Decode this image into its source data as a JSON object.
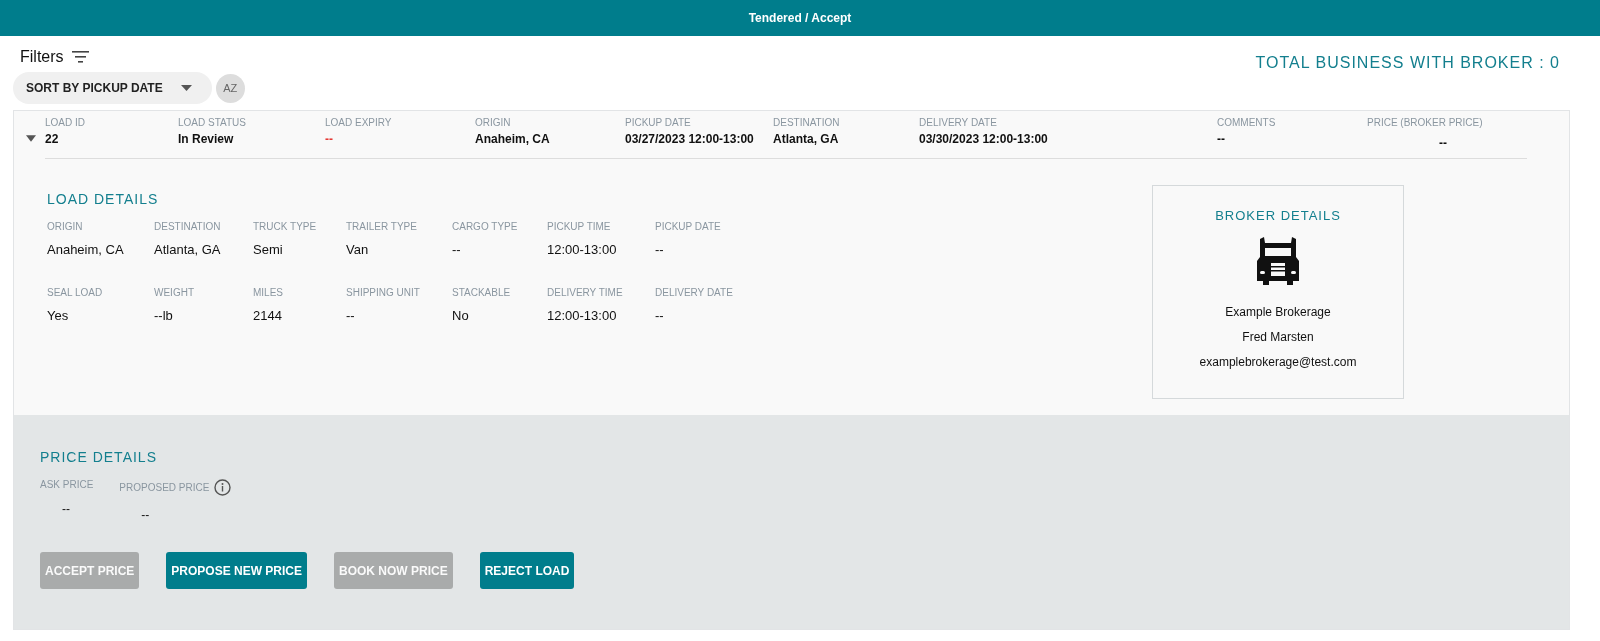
{
  "header": {
    "title": "Tendered / Accept"
  },
  "toolbar": {
    "filters_label": "Filters",
    "sort": {
      "value": "SORT BY PICKUP DATE"
    },
    "sort_order_button": "AZ",
    "total_business": "TOTAL BUSINESS WITH BROKER : 0"
  },
  "load": {
    "expanded": true,
    "summary": [
      {
        "label": "LOAD ID",
        "value": "22",
        "kind": "plain"
      },
      {
        "label": "LOAD STATUS",
        "value": "In Review",
        "kind": "plain"
      },
      {
        "label": "LOAD EXPIRY",
        "value": "--",
        "kind": "alert"
      },
      {
        "label": "ORIGIN",
        "value": "Anaheim, CA",
        "kind": "plain"
      },
      {
        "label": "PICKUP DATE",
        "value": "03/27/2023 12:00-13:00",
        "kind": "plain"
      },
      {
        "label": "DESTINATION",
        "value": "Atlanta, GA",
        "kind": "plain"
      },
      {
        "label": "DELIVERY DATE",
        "value": "03/30/2023 12:00-13:00",
        "kind": "plain"
      },
      {
        "label": "COMMENTS",
        "value": "--",
        "kind": "plain"
      },
      {
        "label": "PRICE (BROKER PRICE)",
        "value": "--",
        "kind": "plain"
      }
    ],
    "load_details": {
      "title": "LOAD DETAILS",
      "rows": [
        [
          {
            "label": "ORIGIN",
            "value": "Anaheim, CA"
          },
          {
            "label": "DESTINATION",
            "value": "Atlanta, GA"
          },
          {
            "label": "TRUCK TYPE",
            "value": "Semi"
          },
          {
            "label": "TRAILER TYPE",
            "value": "Van"
          },
          {
            "label": "CARGO TYPE",
            "value": "--"
          },
          {
            "label": "PICKUP TIME",
            "value": "12:00-13:00"
          },
          {
            "label": "PICKUP DATE",
            "value": "--"
          }
        ],
        [
          {
            "label": "SEAL LOAD",
            "value": "Yes"
          },
          {
            "label": "WEIGHT",
            "value": "--lb"
          },
          {
            "label": "MILES",
            "value": "2144"
          },
          {
            "label": "SHIPPING UNIT",
            "value": "--"
          },
          {
            "label": "STACKABLE",
            "value": "No"
          },
          {
            "label": "DELIVERY TIME",
            "value": "12:00-13:00"
          },
          {
            "label": "DELIVERY DATE",
            "value": "--"
          }
        ]
      ]
    },
    "broker_details": {
      "title": "BROKER DETAILS",
      "company": "Example Brokerage",
      "contact": "Fred Marsten",
      "email": "examplebrokerage@test.com"
    },
    "price_details": {
      "title": "PRICE DETAILS",
      "fields": [
        {
          "label": "ASK PRICE",
          "value": "--",
          "info": false
        },
        {
          "label": "PROPOSED PRICE",
          "value": "--",
          "info": true
        }
      ],
      "buttons": [
        {
          "label": "ACCEPT PRICE",
          "disabled": true
        },
        {
          "label": "PROPOSE NEW PRICE",
          "disabled": false
        },
        {
          "label": "BOOK NOW PRICE",
          "disabled": true
        },
        {
          "label": "REJECT LOAD",
          "disabled": false
        }
      ]
    }
  }
}
